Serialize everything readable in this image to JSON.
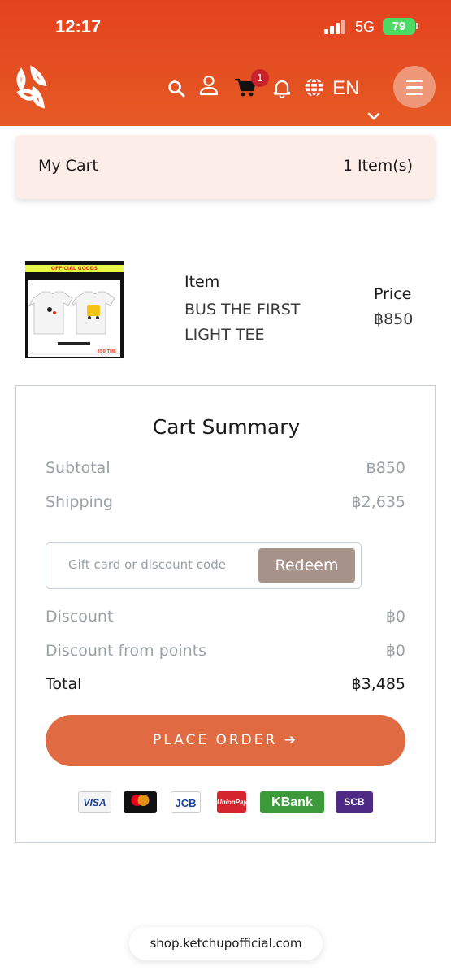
{
  "status_bar": {
    "time": "12:17",
    "network": "5G",
    "battery": "79"
  },
  "header": {
    "logo_icon": "ketchup-logo-icon",
    "icons": [
      "search-icon",
      "user-icon",
      "cart-icon",
      "bell-icon",
      "globe-icon",
      "menu-icon"
    ],
    "cart_count": "1",
    "language": "EN"
  },
  "cart": {
    "title": "My Cart",
    "count_label": "1 Item(s)"
  },
  "item": {
    "heading": "Item",
    "name": "BUS THE FIRST LIGHT TEE",
    "price_heading": "Price",
    "price": "฿850",
    "thumb_banner": "OFFICIAL GOODS"
  },
  "summary": {
    "title": "Cart Summary",
    "subtotal_label": "Subtotal",
    "subtotal_value": "฿850",
    "shipping_label": "Shipping",
    "shipping_value": "฿2,635",
    "code_placeholder": "Gift card or discount code",
    "redeem_label": "Redeem",
    "discount_label": "Discount",
    "discount_value": "฿0",
    "points_label": "Discount from points",
    "points_value": "฿0",
    "total_label": "Total",
    "total_value": "฿3,485",
    "place_order_label": "PLACE ORDER ➔",
    "payment_methods": [
      "VISA",
      "mastercard",
      "JCB",
      "UnionPay",
      "KBank",
      "SCB"
    ]
  },
  "colors": {
    "header": "#e3421f",
    "accent": "#e06b42",
    "redeem": "#a8938b",
    "cart_bar": "#fcede8"
  },
  "url": "shop.ketchupofficial.com"
}
